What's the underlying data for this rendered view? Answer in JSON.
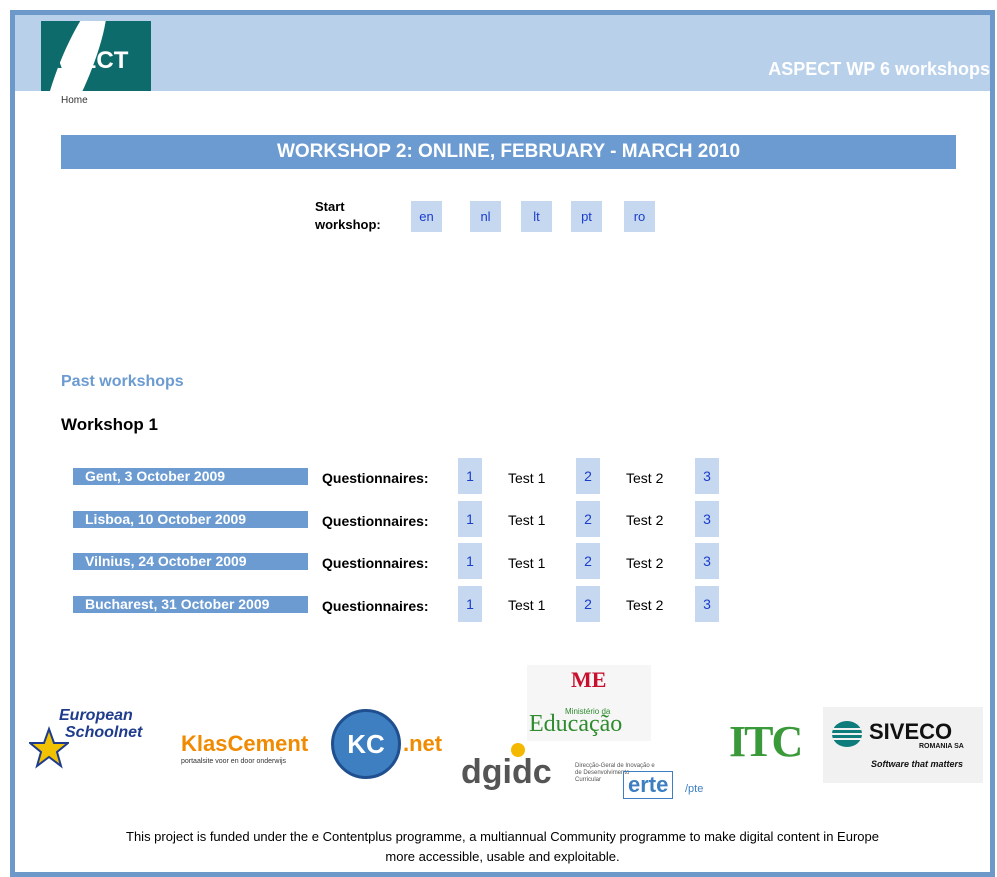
{
  "header": {
    "logo_text_a": "A",
    "logo_text_rest": "PECT",
    "site_title": "ASPECT WP 6 workshops"
  },
  "breadcrumb": {
    "home": "Home"
  },
  "banner": {
    "title": "WORKSHOP 2: ONLINE, FEBRUARY - MARCH 2010"
  },
  "start": {
    "label_line1": "Start",
    "label_line2": "workshop:",
    "languages": [
      "en",
      "nl",
      "lt",
      "pt",
      "ro"
    ]
  },
  "past": {
    "title": "Past workshops",
    "workshop_title": "Workshop 1",
    "questionnaires_label": "Questionnaires:",
    "rows": [
      {
        "city": "Gent, 3 October 2009",
        "q1": "1",
        "test1": "Test 1",
        "q2": "2",
        "test2": "Test 2",
        "q3": "3"
      },
      {
        "city": "Lisboa, 10 October 2009",
        "q1": "1",
        "test1": "Test 1",
        "q2": "2",
        "test2": "Test 2",
        "q3": "3"
      },
      {
        "city": "Vilnius, 24 October 2009",
        "q1": "1",
        "test1": "Test 1",
        "q2": "2",
        "test2": "Test 2",
        "q3": "3"
      },
      {
        "city": "Bucharest, 31 October 2009",
        "q1": "1",
        "test1": "Test 1",
        "q2": "2",
        "test2": "Test 2",
        "q3": "3"
      }
    ]
  },
  "logos": {
    "eun_line1": "European",
    "eun_line2": "Schoolnet",
    "klascement": "KlasCement",
    "klascement_tagline": "portaalsite voor en door onderwijs",
    "kc_net": ".net",
    "kc_mark": "KC",
    "me_mark": "ME",
    "me_small": "Ministério da",
    "me_big": "Educação",
    "dgidc": "dgidc",
    "dgidc_small": "Direcção-Geral de Inovação e de Desenvolvimento Curricular",
    "erte": "erte",
    "erte_suffix": "/pte",
    "itc": "ITC",
    "siveco": "SIVECO",
    "siveco_sub": "ROMANIA SA",
    "siveco_tagline": "Software that matters"
  },
  "footer": {
    "line1": "This project is funded under the e Contentplus programme, a multiannual Community programme to make digital content in Europe",
    "line2": "more accessible, usable and exploitable."
  },
  "colors": {
    "frame": "#6c99c9",
    "header_bg": "#b8d0ea",
    "accent": "#6b9bd1",
    "link": "#1a3dcc",
    "button_bg": "#c5d8ef",
    "logo_teal": "#0d6b6b"
  }
}
